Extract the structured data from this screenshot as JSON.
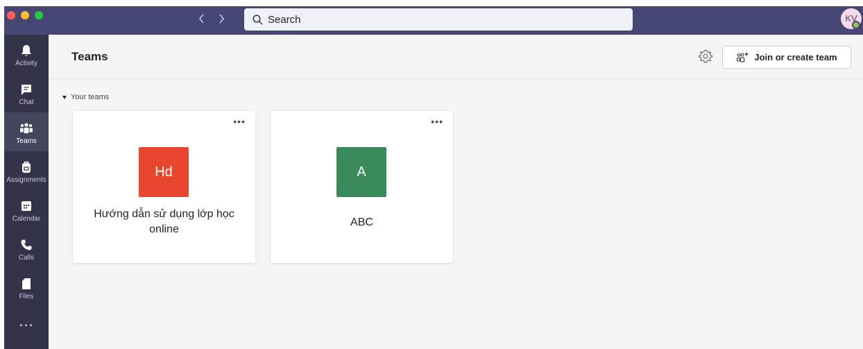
{
  "titlebar": {
    "search_placeholder": "Search",
    "back_icon": "chevron-left-icon",
    "forward_icon": "chevron-right-icon",
    "avatar_initials": "KV",
    "presence_status_color": "#92c353"
  },
  "rail": {
    "items": [
      {
        "label": "Activity",
        "icon": "bell-icon"
      },
      {
        "label": "Chat",
        "icon": "chat-icon"
      },
      {
        "label": "Teams",
        "icon": "teams-icon",
        "active": true
      },
      {
        "label": "Assignments",
        "icon": "backpack-icon"
      },
      {
        "label": "Calendar",
        "icon": "calendar-icon"
      },
      {
        "label": "Calls",
        "icon": "phone-icon"
      },
      {
        "label": "Files",
        "icon": "file-icon"
      }
    ],
    "more_label": "..."
  },
  "header": {
    "title": "Teams",
    "settings_icon": "gear-icon",
    "join_button_label": "Join or create team"
  },
  "section": {
    "label": "Your teams"
  },
  "teams": [
    {
      "initials": "Hd",
      "name": "Hướng dẫn sử dụng lớp học online",
      "color": "#e8462e"
    },
    {
      "initials": "A",
      "name": "ABC",
      "color": "#3b8a5c"
    }
  ],
  "colors": {
    "titlebar": "#464775",
    "rail": "#33344a",
    "content_background": "#f5f5f5"
  }
}
